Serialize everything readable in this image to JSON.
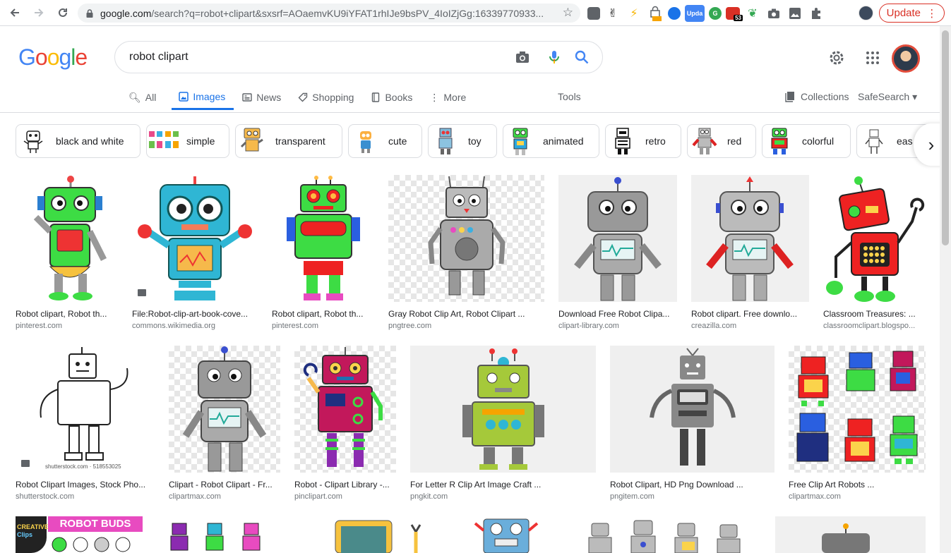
{
  "browser": {
    "url_main": "google.com",
    "url_rest": "/search?q=robot+clipart&sxsrf=AOaemvKU9iYFAT1rhIJe9bsPV_4IoIZjGg:16339770933...",
    "update_label": "Update",
    "ext_badge": "53",
    "ext_upda": "Upda"
  },
  "header": {
    "logo": "Google",
    "query": "robot clipart"
  },
  "tabs": [
    {
      "label": "All"
    },
    {
      "label": "Images"
    },
    {
      "label": "News"
    },
    {
      "label": "Shopping"
    },
    {
      "label": "Books"
    },
    {
      "label": "More"
    }
  ],
  "tools_label": "Tools",
  "collections_label": "Collections",
  "safesearch_label": "SafeSearch",
  "chips": [
    {
      "label": "black and white"
    },
    {
      "label": "simple"
    },
    {
      "label": "transparent"
    },
    {
      "label": "cute"
    },
    {
      "label": "toy"
    },
    {
      "label": "animated"
    },
    {
      "label": "retro"
    },
    {
      "label": "red"
    },
    {
      "label": "colorful"
    },
    {
      "label": "eas"
    }
  ],
  "results": [
    {
      "title": "Robot clipart, Robot th...",
      "source": "pinterest.com"
    },
    {
      "title": "File:Robot-clip-art-book-cove...",
      "source": "commons.wikimedia.org"
    },
    {
      "title": "Robot clipart, Robot th...",
      "source": "pinterest.com"
    },
    {
      "title": "Gray Robot Clip Art, Robot Clipart ...",
      "source": "pngtree.com"
    },
    {
      "title": "Download Free Robot Clipa...",
      "source": "clipart-library.com"
    },
    {
      "title": "Robot clipart. Free downlo...",
      "source": "creazilla.com"
    },
    {
      "title": "Classroom Treasures: ...",
      "source": "classroomclipart.blogspo..."
    },
    {
      "title": "Robot Clipart Images, Stock Pho...",
      "source": "shutterstock.com",
      "img_text": "shutterstock.com · 518553025"
    },
    {
      "title": "Clipart - Robot Clipart - Fr...",
      "source": "clipartmax.com"
    },
    {
      "title": "Robot - Clipart Library -...",
      "source": "pinclipart.com"
    },
    {
      "title": "For Letter R Clip Art Image Craft ...",
      "source": "pngkit.com"
    },
    {
      "title": "Robot Clipart, HD Png Download ...",
      "source": "pngitem.com"
    },
    {
      "title": "Free Clip Art Robots ...",
      "source": "clipartmax.com"
    }
  ],
  "row3": {
    "robot_buds": "ROBOT BUDS",
    "creative": "CREATIVE",
    "clips": "Clips"
  }
}
